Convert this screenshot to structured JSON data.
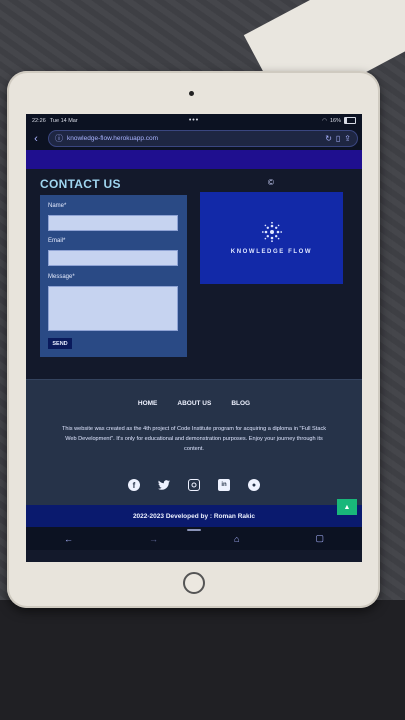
{
  "status": {
    "time": "22:26",
    "date": "Tue 14 Mar",
    "battery": "16%",
    "dots": "•••"
  },
  "browser": {
    "url": "knowledge-flow.herokuapp.com"
  },
  "contact": {
    "title": "CONTACT US",
    "name_label": "Name*",
    "email_label": "Email*",
    "message_label": "Message*",
    "send_label": "SEND"
  },
  "logo": {
    "brand": "KNOWLEDGE FLOW"
  },
  "footer": {
    "nav": [
      "HOME",
      "ABOUT US",
      "BLOG"
    ],
    "blurb": "This website was created as the 4th project of Code Institute program for acquiring a diploma in \"Full Stack Web Development\". It's only for educational and demonstration purposes. Enjoy your journey through its content.",
    "developer": "2022-2023 Developed by : Roman Rakic"
  },
  "colors": {
    "accent": "#1229a8",
    "scroll_top": "#19b77a",
    "footer_bg": "#263349"
  }
}
